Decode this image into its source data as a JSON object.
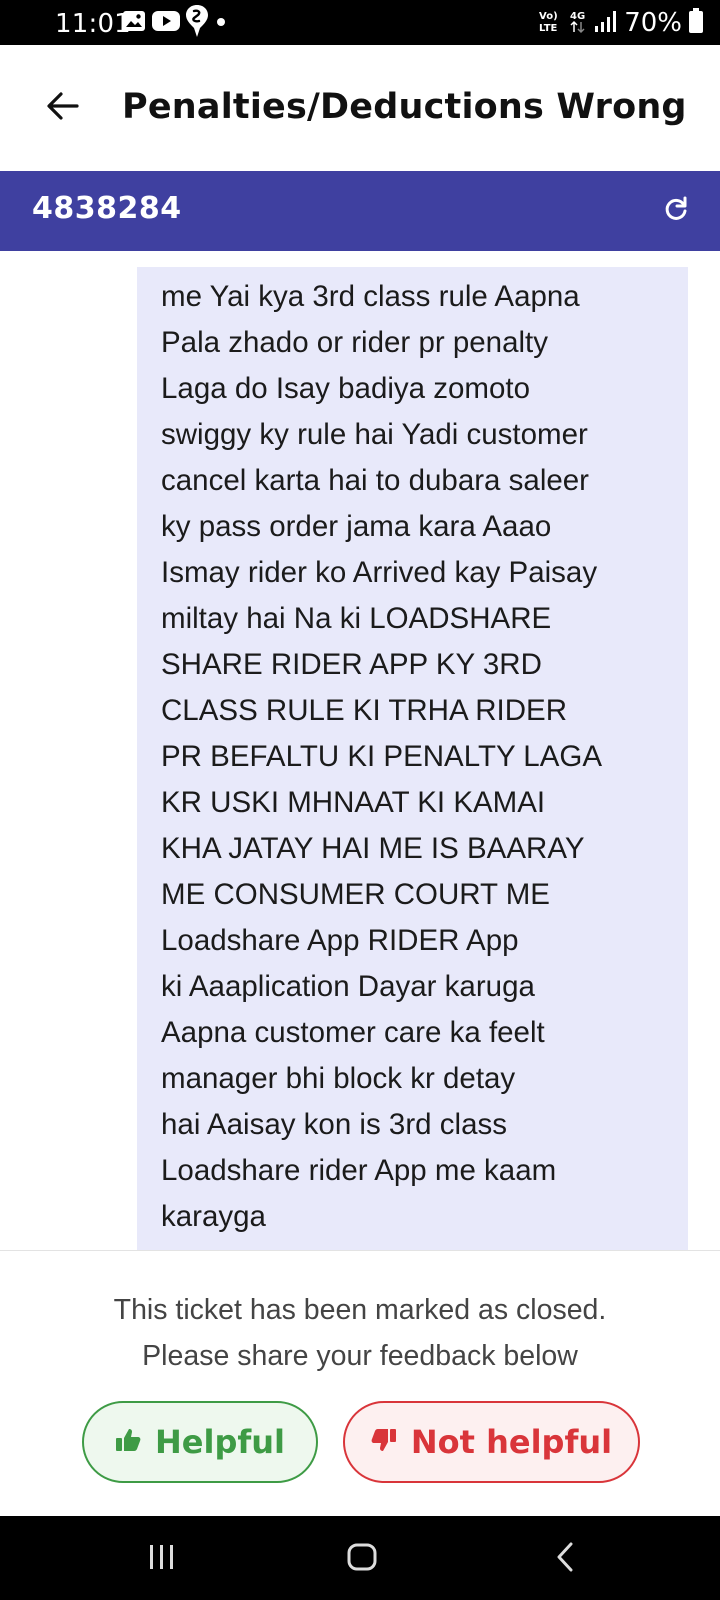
{
  "status_bar": {
    "time": "11:01",
    "network_label": "Vo) LTE",
    "network_type": "4G",
    "battery": "70%",
    "left_icons": [
      "image-icon",
      "youtube-icon",
      "swiggy-icon",
      "dot-icon"
    ],
    "right_icons": [
      "volte-icon",
      "4g-arrows-icon",
      "signal-icon",
      "battery-icon"
    ]
  },
  "header": {
    "title": "Penalties/Deductions Wrong",
    "back_icon": "arrow-left-icon"
  },
  "ticket_bar": {
    "ticket_id": "4838284",
    "refresh_icon": "refresh-icon",
    "color": "#3f40a0"
  },
  "message": {
    "lines": [
      "me Yai kya 3rd class rule Aapna",
      "Pala zhado or rider pr penalty",
      "Laga do Isay badiya zomoto",
      "swiggy ky rule hai Yadi customer",
      "cancel karta hai to dubara saleer",
      "ky pass order jama kara Aaao",
      "Ismay rider ko Arrived kay Paisay",
      "miltay hai Na ki LOADSHARE",
      "SHARE RIDER APP KY 3RD",
      "CLASS RULE KI TRHA RIDER",
      "PR BEFALTU KI PENALTY LAGA",
      "KR USKI MHNAAT KI KAMAI",
      "KHA JATAY HAI ME IS BAARAY",
      "ME CONSUMER COURT ME",
      "Loadshare App RIDER App",
      "ki Aaaplication Dayar karuga",
      "Aapna customer care ka feelt",
      "manager bhi block kr detay",
      "hai Aaisay kon is 3rd class",
      "Loadshare rider App me kaam",
      "karayga"
    ],
    "bubble_color": "#e8e9fa"
  },
  "footer": {
    "closed_line1": "This ticket has been marked as closed.",
    "closed_line2": "Please share your feedback below",
    "helpful_label": "Helpful",
    "not_helpful_label": "Not helpful",
    "helpful_color": "#3e9b45",
    "not_helpful_color": "#d9353a"
  },
  "nav_bar": {
    "items": [
      "recent-apps-icon",
      "home-icon",
      "back-icon"
    ]
  }
}
